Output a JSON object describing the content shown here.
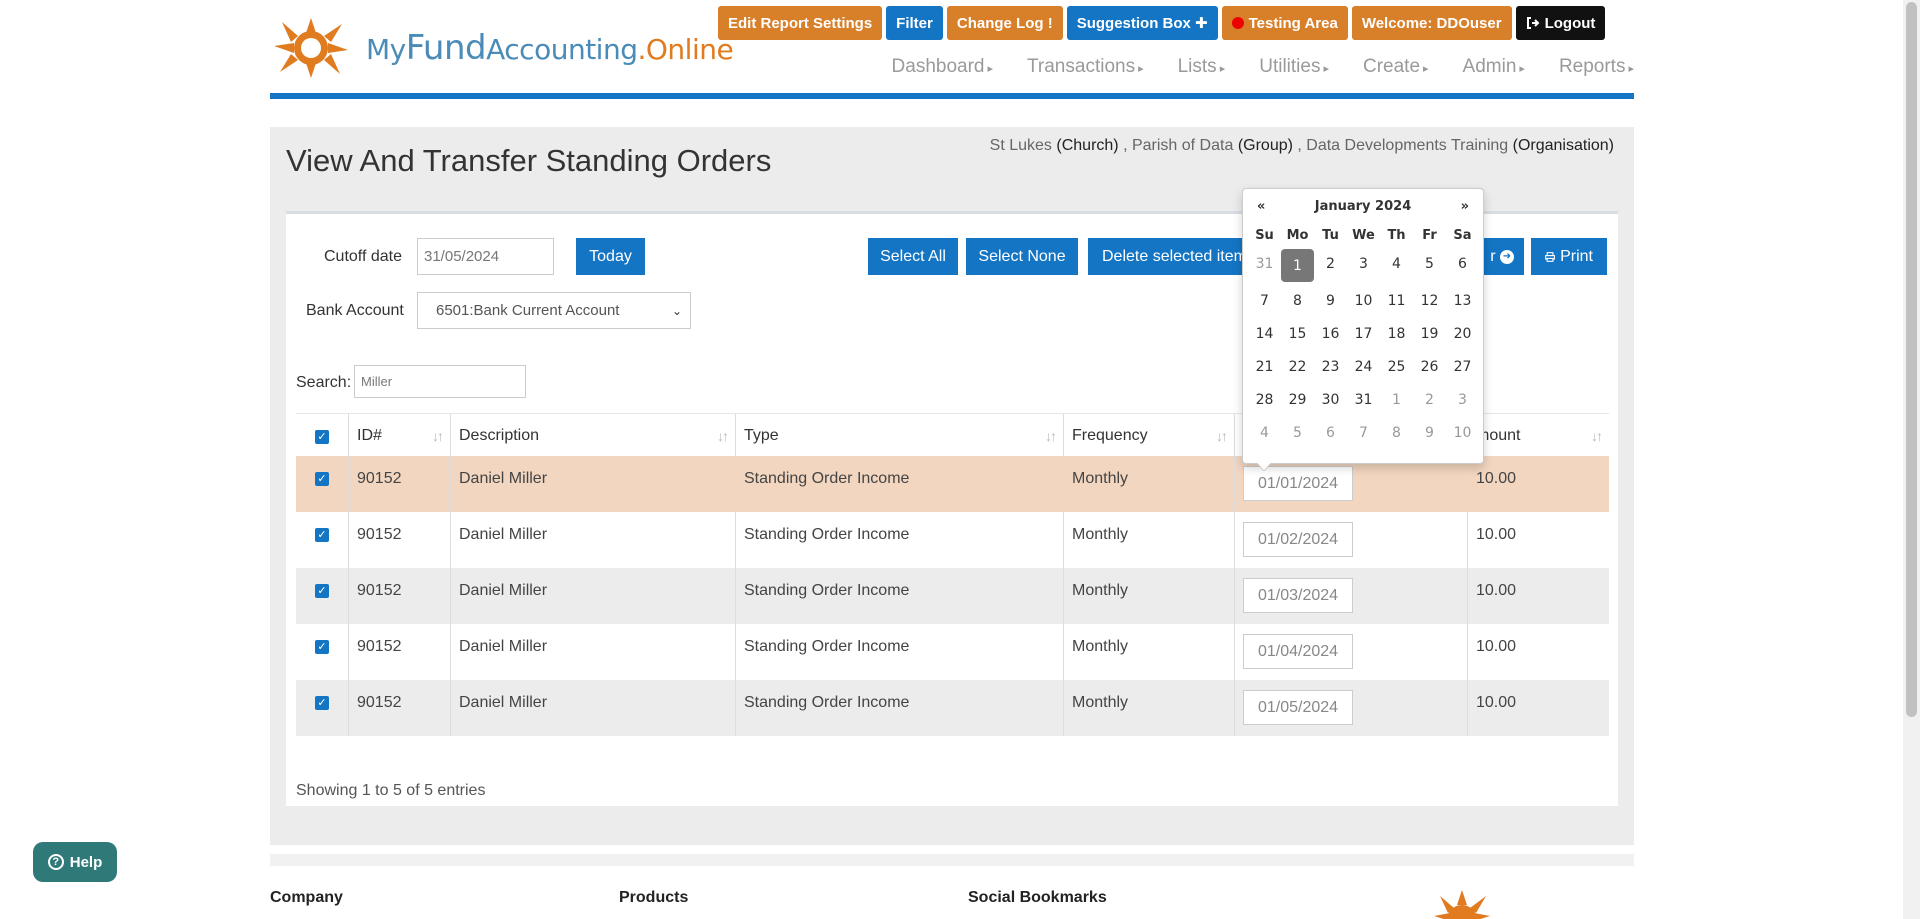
{
  "logo": {
    "my": "My",
    "fund": "Fund",
    "accounting": "Accounting",
    "dot": ".",
    "online": "Online"
  },
  "topbar": {
    "edit_report": "Edit Report Settings",
    "filter": "Filter",
    "change_log": "Change Log",
    "change_log_mark": "!",
    "suggestion": "Suggestion Box",
    "suggestion_mark": "✚",
    "testing": "Testing Area",
    "welcome": "Welcome:  DDOuser",
    "logout": "Logout"
  },
  "nav": [
    {
      "label": "Dashboard"
    },
    {
      "label": "Transactions"
    },
    {
      "label": "Lists"
    },
    {
      "label": "Utilities"
    },
    {
      "label": "Create"
    },
    {
      "label": "Admin"
    },
    {
      "label": "Reports"
    }
  ],
  "breadcrumb": {
    "church": "St Lukes",
    "church_type": "(Church)",
    "group": "Parish of Data",
    "group_type": "(Group)",
    "org": "Data Developments Training",
    "org_type": "(Organisation)"
  },
  "page": {
    "title": "View And Transfer Standing Orders"
  },
  "form": {
    "cutoff_label": "Cutoff date",
    "cutoff_value": "31/05/2024",
    "today_button": "Today",
    "bank_label": "Bank Account",
    "bank_value": "6501:Bank Current Account",
    "select_all": "Select All",
    "select_none": "Select None",
    "delete_selected": "Delete selected item",
    "transfer_partial": "r",
    "print": "Print",
    "search_label": "Search:",
    "search_value": "Miller"
  },
  "table": {
    "headers": [
      "ID#",
      "Description",
      "Type",
      "Frequency",
      "",
      "Amount"
    ],
    "headers_visible": {
      "amount": "mount"
    },
    "rows": [
      {
        "id": "90152",
        "description": "Daniel Miller",
        "type": "Standing Order Income",
        "frequency": "Monthly",
        "date": "01/01/2024",
        "amount": "10.00"
      },
      {
        "id": "90152",
        "description": "Daniel Miller",
        "type": "Standing Order Income",
        "frequency": "Monthly",
        "date": "01/02/2024",
        "amount": "10.00"
      },
      {
        "id": "90152",
        "description": "Daniel Miller",
        "type": "Standing Order Income",
        "frequency": "Monthly",
        "date": "01/03/2024",
        "amount": "10.00"
      },
      {
        "id": "90152",
        "description": "Daniel Miller",
        "type": "Standing Order Income",
        "frequency": "Monthly",
        "date": "01/04/2024",
        "amount": "10.00"
      },
      {
        "id": "90152",
        "description": "Daniel Miller",
        "type": "Standing Order Income",
        "frequency": "Monthly",
        "date": "01/05/2024",
        "amount": "10.00"
      }
    ],
    "footer": "Showing 1 to 5 of 5 entries"
  },
  "calendar": {
    "prev": "«",
    "next": "»",
    "month": "January 2024",
    "dows": [
      "Su",
      "Mo",
      "Tu",
      "We",
      "Th",
      "Fr",
      "Sa"
    ],
    "days": [
      "31",
      "1",
      "2",
      "3",
      "4",
      "5",
      "6",
      "7",
      "8",
      "9",
      "10",
      "11",
      "12",
      "13",
      "14",
      "15",
      "16",
      "17",
      "18",
      "19",
      "20",
      "21",
      "22",
      "23",
      "24",
      "25",
      "26",
      "27",
      "28",
      "29",
      "30",
      "31",
      "1",
      "2",
      "3",
      "4",
      "5",
      "6",
      "7",
      "8",
      "9",
      "10"
    ],
    "muted_days_index": [
      0,
      32,
      33,
      34,
      35,
      36,
      37,
      38,
      39,
      40,
      41
    ],
    "active_index": 1
  },
  "footer": {
    "company": "Company",
    "products": "Products",
    "social": "Social Bookmarks"
  },
  "help": {
    "label": "Help"
  },
  "colors": {
    "brand_blue": "#1475c4",
    "brand_orange": "#d87f2a",
    "highlight_row": "#f2d6c0"
  }
}
